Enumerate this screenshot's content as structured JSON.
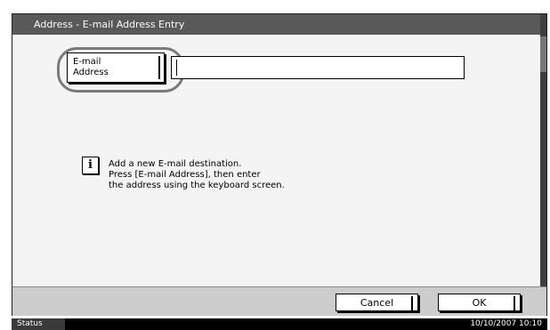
{
  "window": {
    "title": "Address - E-mail Address Entry"
  },
  "email_button": {
    "label_line1": "E-mail",
    "label_line2": "Address"
  },
  "address_input": {
    "value": ""
  },
  "info": {
    "line1": "Add a new E-mail destination.",
    "line2": "Press [E-mail Address], then enter",
    "line3": "the address using the keyboard screen."
  },
  "buttons": {
    "cancel": "Cancel",
    "ok": "OK"
  },
  "status": {
    "label": "Status",
    "datetime": "10/10/2007   10:10"
  },
  "icons": {
    "info": "info-icon"
  }
}
